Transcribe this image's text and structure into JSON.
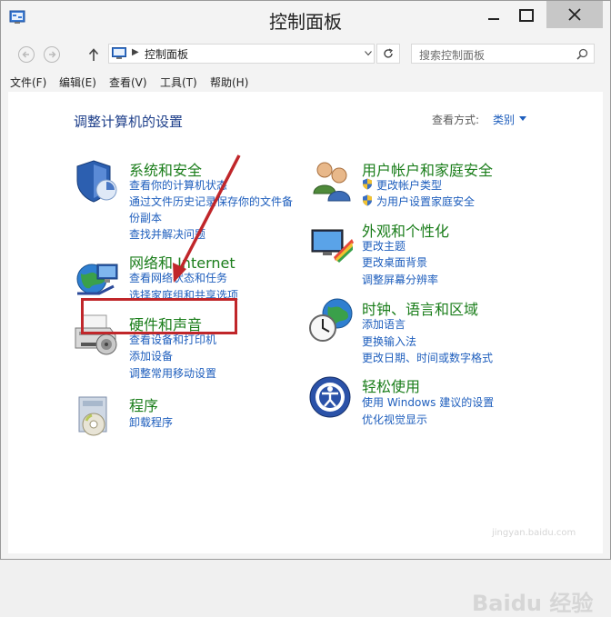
{
  "window": {
    "title": "控制面板"
  },
  "address": {
    "path": "控制面板",
    "search_placeholder": "搜索控制面板"
  },
  "menu": [
    {
      "label": "文件(F)"
    },
    {
      "label": "编辑(E)"
    },
    {
      "label": "查看(V)"
    },
    {
      "label": "工具(T)"
    },
    {
      "label": "帮助(H)"
    }
  ],
  "main": {
    "heading": "调整计算机的设置",
    "view_by_label": "查看方式:",
    "view_by_value": "类别"
  },
  "categories": [
    {
      "title": "系统和安全",
      "icon": "shield-icon",
      "links": [
        "查看你的计算机状态",
        "通过文件历史记录保存你的文件备",
        "份副本",
        "查找并解决问题"
      ]
    },
    {
      "title": "网络和 Internet",
      "icon": "network-icon",
      "links": [
        "查看网络状态和任务",
        "选择家庭组和共享选项"
      ]
    },
    {
      "title": "硬件和声音",
      "icon": "printer-icon",
      "links": [
        "查看设备和打印机",
        "添加设备",
        "调整常用移动设置"
      ]
    },
    {
      "title": "程序",
      "icon": "programs-icon",
      "links": [
        "卸载程序"
      ]
    },
    {
      "title": "用户帐户和家庭安全",
      "icon": "users-icon",
      "links": [
        "更改帐户类型",
        "为用户设置家庭安全"
      ]
    },
    {
      "title": "外观和个性化",
      "icon": "appearance-icon",
      "links": [
        "更改主题",
        "更改桌面背景",
        "调整屏幕分辨率"
      ]
    },
    {
      "title": "时钟、语言和区域",
      "icon": "clock-globe-icon",
      "links": [
        "添加语言",
        "更换输入法",
        "更改日期、时间或数字格式"
      ]
    },
    {
      "title": "轻松使用",
      "icon": "ease-of-access-icon",
      "links": [
        "使用 Windows 建议的设置",
        "优化视觉显示"
      ]
    }
  ],
  "annotation": {
    "color": "#c0262a"
  },
  "watermark": {
    "text": "Baidu 经验",
    "url": "jingyan.baidu.com"
  },
  "colors": {
    "category_title": "#1a7d1a",
    "link": "#1e5ebd",
    "heading": "#1e3f8a"
  }
}
